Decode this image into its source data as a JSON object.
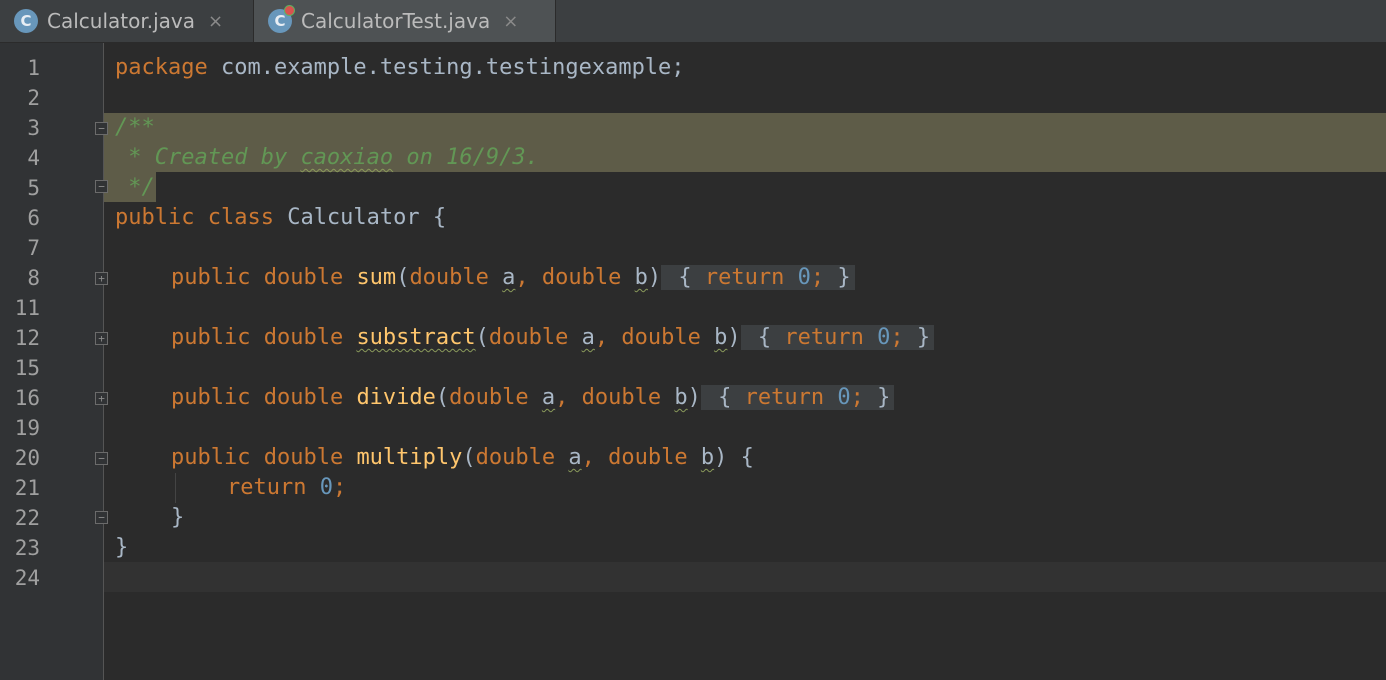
{
  "tabs": [
    {
      "label": "Calculator.java",
      "icon": "C",
      "close": "×",
      "active": false
    },
    {
      "label": "CalculatorTest.java",
      "icon": "C",
      "close": "×",
      "active": true
    }
  ],
  "line_numbers": [
    "1",
    "2",
    "3",
    "4",
    "5",
    "6",
    "7",
    "8",
    "11",
    "12",
    "15",
    "16",
    "19",
    "20",
    "21",
    "22",
    "23",
    "24"
  ],
  "code": {
    "l1_kw": "package",
    "l1_rest": " com.example.testing.testingexample;",
    "l3": "/**",
    "l4_a": " * Created by ",
    "l4_author": "caoxiao",
    "l4_b": " on 16/9/3.",
    "l5": " */",
    "l6_kw": "public class",
    "l6_rest": " Calculator {",
    "methods": [
      {
        "mods": "public double",
        "name": "sum",
        "p1": "double",
        "a": "a",
        "p2": "double",
        "b": "b",
        "body_kw": "return",
        "body_num": "0"
      },
      {
        "mods": "public double",
        "name": "substract",
        "p1": "double",
        "a": "a",
        "p2": "double",
        "b": "b",
        "body_kw": "return",
        "body_num": "0"
      },
      {
        "mods": "public double",
        "name": "divide",
        "p1": "double",
        "a": "a",
        "p2": "double",
        "b": "b",
        "body_kw": "return",
        "body_num": "0"
      },
      {
        "mods": "public double",
        "name": "multiply",
        "p1": "double",
        "a": "a",
        "p2": "double",
        "b": "b",
        "body_kw": "return",
        "body_num": "0"
      }
    ],
    "close_brace": "}"
  },
  "colors": {
    "keyword": "#cc7832",
    "number": "#6897bb",
    "function": "#ffc66d",
    "comment": "#629755",
    "text": "#a9b7c6"
  }
}
